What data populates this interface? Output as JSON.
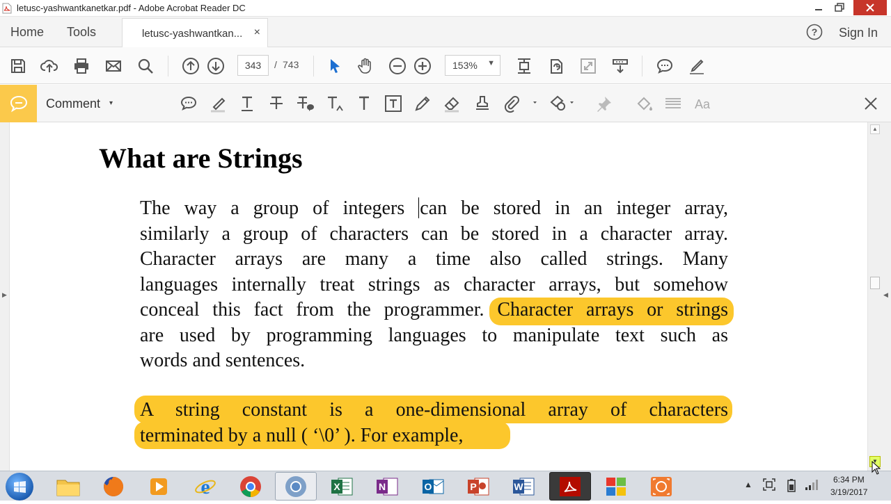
{
  "window": {
    "title": "letusc-yashwantkanetkar.pdf - Adobe Acrobat Reader DC"
  },
  "menu": {
    "home": "Home",
    "tools": "Tools",
    "doc_tab": "letusc-yashwantkan...",
    "doc_tab_close": "×",
    "sign_in": "Sign In"
  },
  "toolbar": {
    "page_current": "343",
    "page_separator": "/",
    "page_total": "743",
    "zoom": "153%",
    "icons": [
      "save-icon",
      "upload-icon",
      "print-icon",
      "email-icon",
      "search-icon",
      "prev-page-icon",
      "next-page-icon",
      "select-cursor-icon",
      "hand-icon",
      "zoom-out-icon",
      "zoom-in-icon",
      "page-fit-icon",
      "rotate-icon",
      "fullscreen-icon",
      "read-mode-icon",
      "comment-icon",
      "sign-icon"
    ]
  },
  "comment_bar": {
    "label": "Comment",
    "caret": "▾",
    "tools": [
      "sticky-note-icon",
      "highlight-icon",
      "underline-icon",
      "strikethrough-icon",
      "replace-text-icon",
      "insert-text-icon",
      "add-text-icon",
      "text-box-icon",
      "pencil-icon",
      "eraser-icon",
      "stamp-icon",
      "attach-icon",
      "shapes-icon",
      "pin-icon",
      "fill-icon",
      "lines-icon",
      "text-style-icon"
    ],
    "text_style_label": "Aa"
  },
  "document": {
    "heading": "What are Strings",
    "para1_lines": [
      [
        "The way a group of integers ",
        "can be stored in an integer array,"
      ],
      "similarly a group of characters can be stored in a character array.",
      "Character arrays are many a time also called strings. Many",
      "languages internally treat strings as character arrays, but somehow",
      [
        "conceal this fact from the programmer. ",
        "Character arrays or strings"
      ],
      "are used by programming languages to manipulate text such as",
      "words and sentences."
    ],
    "para2_lines": [
      "A string constant is a one-dimensional array of characters",
      "terminated by a null ( ‘\\0’ ). For example,"
    ]
  },
  "taskbar": {
    "apps": [
      "windows-start",
      "file-explorer",
      "firefox",
      "media-player",
      "internet-explorer",
      "chrome",
      "chrome-alt",
      "excel",
      "onenote",
      "outlook",
      "powerpoint",
      "word",
      "acrobat",
      "media-center",
      "screen-recorder"
    ],
    "time": "6:34 PM",
    "date": "3/19/2017"
  },
  "colors": {
    "highlight": "#fcc72c",
    "comment_badge": "#fbc94b",
    "close_button": "#c7352a",
    "select_tool": "#1c6fd1"
  }
}
